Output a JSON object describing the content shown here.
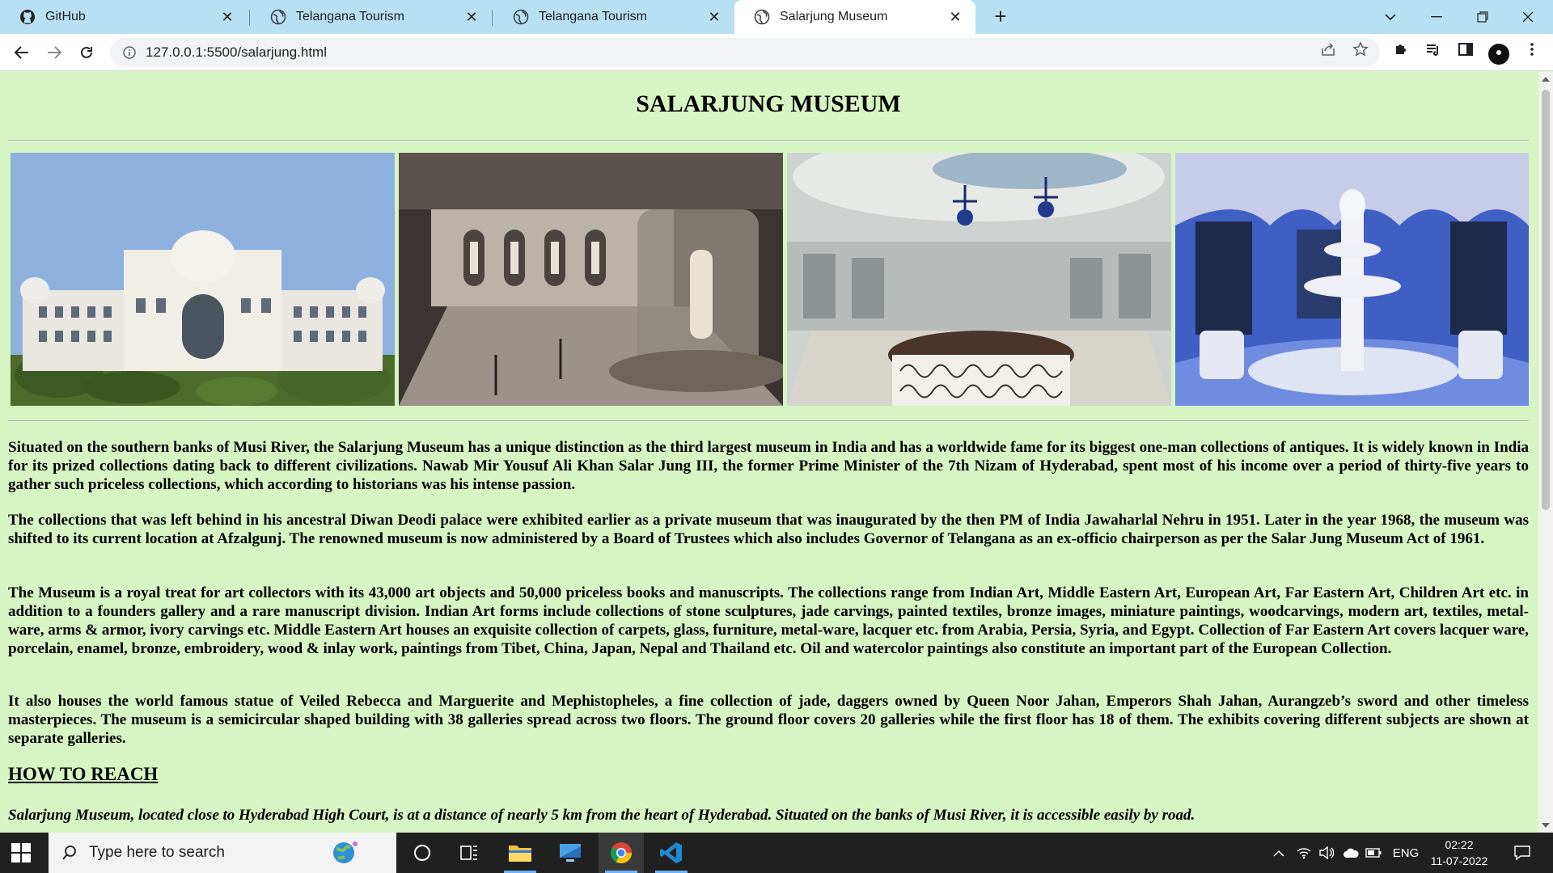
{
  "browser": {
    "tabs": [
      {
        "title": "GitHub",
        "icon": "github-icon",
        "active": false
      },
      {
        "title": "Telangana Tourism",
        "icon": "globe-icon",
        "active": false
      },
      {
        "title": "Telangana Tourism",
        "icon": "globe-icon",
        "active": false
      },
      {
        "title": "Salarjung Museum",
        "icon": "globe-icon",
        "active": true
      }
    ],
    "new_tab_label": "+",
    "address": "127.0.0.1:5500/salarjung.html"
  },
  "page": {
    "title": "SALARJUNG MUSEUM",
    "images": [
      {
        "name": "museum-exterior-image",
        "subject": "Salarjung Museum building exterior"
      },
      {
        "name": "gallery-hall-image",
        "subject": "Gallery hall with statue in glass case"
      },
      {
        "name": "chandelier-hall-image",
        "subject": "Hall with chandeliers and railing"
      },
      {
        "name": "fountain-room-image",
        "subject": "Marble fountain room"
      }
    ],
    "paragraphs": [
      "Situated on the southern banks of Musi River, the Salarjung Museum has a unique distinction as the third largest museum in India and has a worldwide fame for its biggest one-man collections of antiques. It is widely known in India for its prized collections dating back to different civilizations. Nawab Mir Yousuf Ali Khan Salar Jung III, the former Prime Minister of the 7th Nizam of Hyderabad, spent most of his income over a period of thirty-five years to gather such priceless collections, which according to historians was his intense passion.",
      "The collections that was left behind in his ancestral Diwan Deodi palace were exhibited earlier as a private museum that was inaugurated by the then PM of India Jawaharlal Nehru in 1951. Later in the year 1968, the museum was shifted to its current location at Afzalgunj. The renowned museum is now administered by a Board of Trustees which also includes Governor of Telangana as an ex-officio chairperson as per the Salar Jung Museum Act of 1961.",
      "The Museum is a royal treat for art collectors with its 43,000 art objects and 50,000 priceless books and manuscripts. The collections range from Indian Art, Middle Eastern Art, European Art, Far Eastern Art, Children Art etc. in addition to a founders gallery and a rare manuscript division. Indian Art forms include collections of stone sculptures, jade carvings, painted textiles, bronze images, miniature paintings, woodcarvings, modern art, textiles, metal-ware, arms & armor, ivory carvings etc. Middle Eastern Art houses an exquisite collection of carpets, glass, furniture, metal-ware, lacquer etc. from Arabia, Persia, Syria, and Egypt. Collection of Far Eastern Art covers lacquer ware, porcelain, enamel, bronze, embroidery, wood & inlay work, paintings from Tibet, China, Japan, Nepal and Thailand etc. Oil and watercolor paintings also constitute an important part of the European Collection.",
      "It also houses the world famous statue of Veiled Rebecca and Marguerite and Mephistopheles, a fine collection of jade, daggers owned by Queen Noor Jahan, Emperors Shah Jahan, Aurangzeb’s sword and other timeless masterpieces. The museum is a semicircular shaped building with 38 galleries spread across two floors. The ground floor covers 20 galleries while the first floor has 18 of them. The exhibits covering different subjects are shown at separate galleries."
    ],
    "how_to_reach_heading": "HOW TO REACH",
    "how_to_reach_text": "Salarjung Museum, located close to Hyderabad High Court, is at a distance of nearly 5 km from the heart of Hyderabad. Situated on the banks of Musi River, it is accessible easily by road."
  },
  "taskbar": {
    "search_placeholder": "Type here to search",
    "language": "ENG",
    "time": "02:22",
    "date": "11-07-2022"
  },
  "colors": {
    "page_background": "#d7f5c3",
    "tabstrip": "#b7e1f3",
    "taskbar": "#202020"
  }
}
